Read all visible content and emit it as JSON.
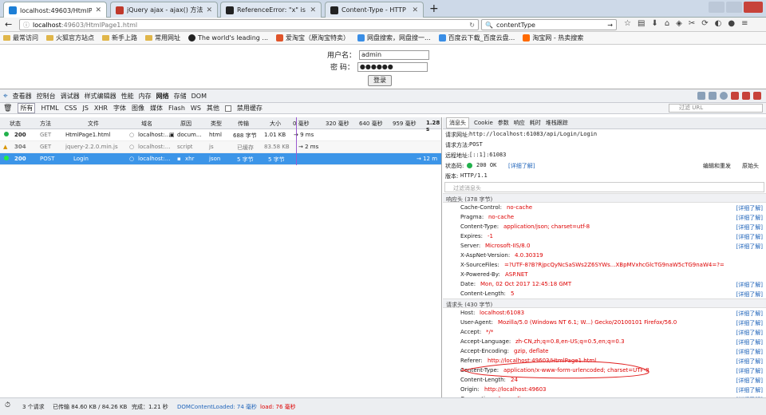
{
  "tabs": [
    {
      "title": "localhost:49603/HtmlPage1.ht",
      "color": "#1d7fd6"
    },
    {
      "title": "jQuery ajax - ajax() 方法",
      "color": "#c0392b"
    },
    {
      "title": "ReferenceError: \"x\" is not d",
      "color": "#222222"
    },
    {
      "title": "Content-Type - HTTP | MD",
      "color": "#222222"
    }
  ],
  "url": {
    "host": "localhost",
    "rest": ":49603/HtmlPage1.html"
  },
  "search": {
    "value": "contentType"
  },
  "bookmarks": [
    "最常访问",
    "火狐官方站点",
    "新手上路",
    "常用网址",
    "The world's leading ...",
    "爱淘宝（原淘宝特卖）",
    "网盘搜索，网盘搜一...",
    "百度云下载_百度云盘...",
    "淘宝网 - 热卖搜索"
  ],
  "form": {
    "user_label": "用户名：",
    "user_value": "admin",
    "pwd_label": "密  码：",
    "pwd_value": "●●●●●●",
    "login_label": "登录"
  },
  "devtools": {
    "tabs": [
      "查看器",
      "控制台",
      "调试器",
      "样式编辑器",
      "性能",
      "内存",
      "网络",
      "存储",
      "DOM"
    ],
    "selected": "网络"
  },
  "netfilters": [
    "所有",
    "HTML",
    "CSS",
    "JS",
    "XHR",
    "字体",
    "图像",
    "媒体",
    "Flash",
    "WS",
    "其他"
  ],
  "disable_cache": "禁用缓存",
  "filter_url_placeholder": "过滤 URL",
  "columns": {
    "status": "状态",
    "method": "方法",
    "file": "文件",
    "domain": "域名",
    "cause": "原因",
    "type": "类型",
    "transfer": "传输",
    "size": "大小",
    "t0": "0 毫秒",
    "t1": "320 毫秒",
    "t2": "640 毫秒",
    "t3": "959 毫秒",
    "t4": "1.28 s"
  },
  "requests": [
    {
      "status": "200",
      "method": "GET",
      "file": "HtmlPage1.html",
      "domain": "localhost:...",
      "cause": "docum...",
      "type": "html",
      "transfer": "688 字节",
      "size": "1.01 KB",
      "timing": "→ 9 ms",
      "dot": "#22b14c"
    },
    {
      "status": "304",
      "method": "GET",
      "file": "jquery-2.2.0.min.js",
      "domain": "localhost:...",
      "cause": "script",
      "type": "js",
      "transfer": "已缓存",
      "size": "83.58 KB",
      "timing": "→ 2 ms",
      "dot": "#f0b400"
    },
    {
      "status": "200",
      "method": "POST",
      "file": "Login",
      "domain": "localhost:...",
      "cause": "xhr",
      "type": "json",
      "transfer": "5 字节",
      "size": "5 字节",
      "timing": "→ 12 m",
      "dot": "#22ee44"
    }
  ],
  "details": {
    "tabs": [
      "消息头",
      "Cookie",
      "参数",
      "响应",
      "耗时",
      "堆栈跟踪"
    ],
    "req_url_label": "请求网址:",
    "req_url": "http://localhost:61083/api/Login/Login",
    "req_method_label": "请求方法:",
    "req_method": "POST",
    "remote_label": "远程地址:",
    "remote": "[::1]:61083",
    "status_label": "状态码:",
    "status_code": "200 OK",
    "status_more": "[详细了解]",
    "edit_resend": "编辑和重发",
    "raw_headers": "原始头",
    "version_label": "版本:",
    "version": "HTTP/1.1",
    "filter_headers": "过滤消息头",
    "response_headers_title": "响应头 (378 字节)",
    "response_headers": [
      {
        "k": "Cache-Control:",
        "v": "no-cache",
        "more": "[详细了解]"
      },
      {
        "k": "Pragma:",
        "v": "no-cache",
        "more": "[详细了解]"
      },
      {
        "k": "Content-Type:",
        "v": "application/json; charset=utf-8",
        "more": "[详细了解]"
      },
      {
        "k": "Expires:",
        "v": "-1",
        "more": "[详细了解]"
      },
      {
        "k": "Server:",
        "v": "Microsoft-IIS/8.0",
        "more": "[详细了解]"
      },
      {
        "k": "X-AspNet-Version:",
        "v": "4.0.30319",
        "more": ""
      },
      {
        "k": "X-SourceFiles:",
        "v": "=?UTF-8?B?RjpcQyNcSaSWs2Z6SYWs...XBpMVxhcGlcTG9naW5cTG9naW4=?=",
        "more": ""
      },
      {
        "k": "X-Powered-By:",
        "v": "ASP.NET",
        "more": ""
      },
      {
        "k": "Date:",
        "v": "Mon, 02 Oct 2017 12:45:18 GMT",
        "more": "[详细了解]"
      },
      {
        "k": "Content-Length:",
        "v": "5",
        "more": "[详细了解]"
      }
    ],
    "request_headers_title": "请求头 (430 字节)",
    "request_headers": [
      {
        "k": "Host:",
        "v": "localhost:61083",
        "more": "[详细了解]"
      },
      {
        "k": "User-Agent:",
        "v": "Mozilla/5.0 (Windows NT 6.1; W...) Gecko/20100101 Firefox/56.0",
        "more": "[详细了解]"
      },
      {
        "k": "Accept:",
        "v": "*/*",
        "more": "[详细了解]"
      },
      {
        "k": "Accept-Language:",
        "v": "zh-CN,zh;q=0.8,en-US;q=0.5,en;q=0.3",
        "more": "[详细了解]"
      },
      {
        "k": "Accept-Encoding:",
        "v": "gzip, deflate",
        "more": "[详细了解]"
      },
      {
        "k": "Referer:",
        "v": "http://localhost:49603/HtmlPage1.html",
        "more": "[详细了解]"
      },
      {
        "k": "Content-Type:",
        "v": "application/x-www-form-urlencoded; charset=UTF-8",
        "more": "[详细了解]"
      },
      {
        "k": "Content-Length:",
        "v": "24",
        "more": "[详细了解]"
      },
      {
        "k": "Origin:",
        "v": "http://localhost:49603",
        "more": "[详细了解]"
      },
      {
        "k": "Connection:",
        "v": "keep-alive",
        "more": "[详细了解]"
      }
    ]
  },
  "statusbar": {
    "requests": "3 个请求",
    "transferred": "已传输 84.60 KB / 84.26 KB",
    "finish": "完成：1.21 秒",
    "dcl": "DOMContentLoaded: 74 毫秒",
    "load": "load: 76 毫秒"
  }
}
